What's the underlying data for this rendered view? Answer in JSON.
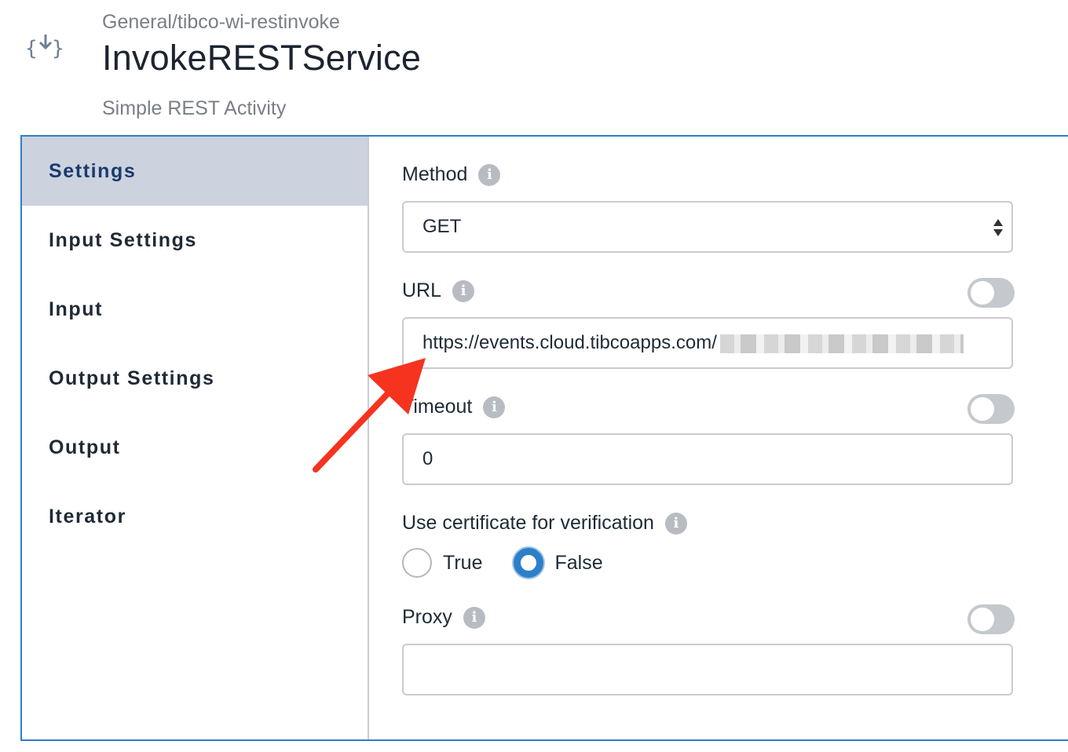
{
  "header": {
    "breadcrumb": "General/tibco-wi-restinvoke",
    "title": "InvokeRESTService",
    "subtitle": "Simple REST Activity",
    "icon": "rest-activity-icon"
  },
  "sidebar": {
    "items": [
      {
        "label": "Settings",
        "active": true
      },
      {
        "label": "Input Settings"
      },
      {
        "label": "Input"
      },
      {
        "label": "Output Settings"
      },
      {
        "label": "Output"
      },
      {
        "label": "Iterator"
      }
    ]
  },
  "fields": {
    "method": {
      "label": "Method",
      "value": "GET"
    },
    "url": {
      "label": "URL",
      "value": "https://events.cloud.tibcoapps.com/",
      "toggle": "off"
    },
    "timeout": {
      "label": "Timeout",
      "value": "0",
      "toggle": "off"
    },
    "certificate": {
      "label": "Use certificate for verification",
      "options": [
        "True",
        "False"
      ],
      "selected": "False"
    },
    "proxy": {
      "label": "Proxy",
      "value": "",
      "toggle": "off"
    }
  },
  "colors": {
    "accent": "#2d7fc8",
    "active_nav_bg": "#ccd3de",
    "annotation_arrow": "#f5331f"
  }
}
